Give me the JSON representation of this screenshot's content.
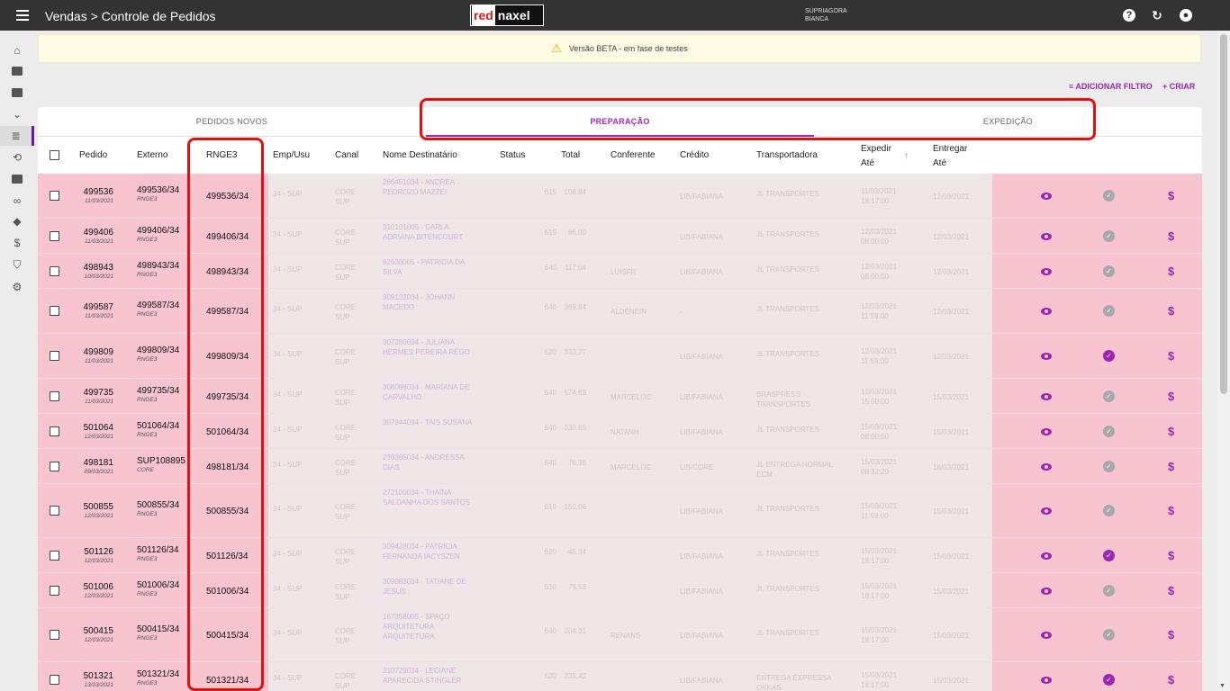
{
  "header": {
    "breadcrumb": "Vendas > Controle de Pedidos",
    "logo_red": "red",
    "logo_rest": "naxel",
    "user_line1": "SUPRIAGORA",
    "user_line2": "BIANCA"
  },
  "banner": {
    "text": "Versão BETA - em fase de testes"
  },
  "actions": {
    "filter": "ADICIONAR FILTRO",
    "create": "CRIAR"
  },
  "tabs": [
    {
      "label": "PEDIDOS NOVOS"
    },
    {
      "label": "PREPARAÇÃO"
    },
    {
      "label": "EXPEDIÇÃO"
    }
  ],
  "columns": {
    "pedido": "Pedido",
    "externo": "Externo",
    "rnge3": "RNGE3",
    "emp": "Emp/Usu",
    "canal": "Canal",
    "nome": "Nome Destinatário",
    "status": "Status",
    "total": "Total",
    "conferente": "Conferente",
    "credito": "Crédito",
    "transportadora": "Transportadora",
    "expedir1": "Expedir",
    "expedir2": "Até",
    "entregar1": "Entregar",
    "entregar2": "Até"
  },
  "rows": [
    {
      "pedido": "499536",
      "date": "11/03/2021",
      "externo": "499536/34",
      "sub": "RNGE3",
      "rnge": "499536/34",
      "nome": "266451034 - ANDREA PEDROZO MAZZEI",
      "status": "615",
      "total": "108,84",
      "conf": "",
      "cred": "LIB/FABIANA",
      "trans": "JL TRANSPORTES",
      "exp": "11/03/2021",
      "exp2": "18:17:00",
      "ent": "12/03/2021",
      "done": false
    },
    {
      "pedido": "499406",
      "date": "11/03/2021",
      "externo": "499406/34",
      "sub": "RNGE3",
      "rnge": "499406/34",
      "nome": "310101005 - CARLA ADRIANA BITENCOURT",
      "status": "615",
      "total": "86,00",
      "conf": "",
      "cred": "LIB/FABIANA",
      "trans": "JL TRANSPORTES",
      "exp": "12/03/2021",
      "exp2": "08:00:00",
      "ent": "12/03/2021",
      "done": false
    },
    {
      "pedido": "498943",
      "date": "10/03/2021",
      "externo": "498943/34",
      "sub": "RNGE3",
      "rnge": "498943/34",
      "nome": "62530005 - PATRICIA DA SILVA",
      "status": "640",
      "total": "117,04",
      "conf": "LUISFR",
      "cred": "LIB/FABIANA",
      "trans": "JL TRANSPORTES",
      "exp": "12/03/2021",
      "exp2": "08:00:00",
      "ent": "12/03/2021",
      "done": false
    },
    {
      "pedido": "499587",
      "date": "11/03/2021",
      "externo": "499587/34",
      "sub": "RNGE3",
      "rnge": "499587/34",
      "nome": "309132034 - JOHANN MACEDO",
      "status": "640",
      "total": "369,84",
      "conf": "ALDENEIN",
      "cred": "-",
      "trans": "JL TRANSPORTES",
      "exp": "12/03/2021",
      "exp2": "11:59:00",
      "ent": "12/03/2021",
      "done": false
    },
    {
      "pedido": "499809",
      "date": "11/03/2021",
      "externo": "499809/34",
      "sub": "RNGE3",
      "rnge": "499809/34",
      "nome": "307280034 - JULIANA HERMES PEREIRA RÊGO",
      "status": "620",
      "total": "333,77",
      "conf": "",
      "cred": "LIB/FABIANA",
      "trans": "JL TRANSPORTES",
      "exp": "12/03/2021",
      "exp2": "11:59:00",
      "ent": "12/03/2021",
      "done": true
    },
    {
      "pedido": "499735",
      "date": "11/03/2021",
      "externo": "499735/34",
      "sub": "RNGE3",
      "rnge": "499735/34",
      "nome": "308088034 - MARIANA DE CARVALHO",
      "status": "640",
      "total": "574,69",
      "conf": "MARCELOC",
      "cred": "LIB/FABIANA",
      "trans": "BRASPRESS TRANSPORTES",
      "exp": "12/03/2021",
      "exp2": "15:00:00",
      "ent": "15/03/2021",
      "done": false
    },
    {
      "pedido": "501064",
      "date": "12/03/2021",
      "externo": "501064/34",
      "sub": "RNGE3",
      "rnge": "501064/34",
      "nome": "307944034 - TAIS SUSANA",
      "status": "640",
      "total": "230,85",
      "conf": "NATANH",
      "cred": "LIB/FABIANA",
      "trans": "JL TRANSPORTES",
      "exp": "15/03/2021",
      "exp2": "08:00:00",
      "ent": "15/03/2021",
      "done": false
    },
    {
      "pedido": "498181",
      "date": "09/03/2021",
      "externo": "SUP108895",
      "sub": "CORE",
      "rnge": "498181/34",
      "nome": "239365034 - ANDRESSA DIAS",
      "status": "640",
      "total": "76,36",
      "conf": "MARCELOC",
      "cred": "LIB/CORE",
      "trans": "JL ENTREGA NORMAL ECM",
      "exp": "15/03/2021",
      "exp2": "08:32:20",
      "ent": "16/03/2021",
      "done": false
    },
    {
      "pedido": "500855",
      "date": "12/03/2021",
      "externo": "500855/34",
      "sub": "RNGE3",
      "rnge": "500855/34",
      "nome": "272100034 - THAÍNA SALDANHA DOS SANTOS",
      "status": "610",
      "total": "150,06",
      "conf": "",
      "cred": "LIB/FABIANA",
      "trans": "JL TRANSPORTES",
      "exp": "15/03/2021",
      "exp2": "11:59:00",
      "ent": "15/03/2021",
      "done": false
    },
    {
      "pedido": "501126",
      "date": "12/03/2021",
      "externo": "501126/34",
      "sub": "RNGE3",
      "rnge": "501126/34",
      "nome": "309428034 - PATRÍCIA FERNANDA IACYSZEN",
      "status": "620",
      "total": "45,34",
      "conf": "",
      "cred": "LIB/FABIANA",
      "trans": "JL TRANSPORTES",
      "exp": "15/03/2021",
      "exp2": "18:17:00",
      "ent": "15/03/2021",
      "done": true
    },
    {
      "pedido": "501006",
      "date": "12/03/2021",
      "externo": "501006/34",
      "sub": "RNGE3",
      "rnge": "501006/34",
      "nome": "309083034 - TATIANE DE JESUS",
      "status": "610",
      "total": "78,52",
      "conf": "",
      "cred": "LIB/FABIANA",
      "trans": "JL TRANSPORTES",
      "exp": "15/03/2021",
      "exp2": "18:17:00",
      "ent": "15/03/2021",
      "done": false
    },
    {
      "pedido": "500415",
      "date": "12/03/2021",
      "externo": "500415/34",
      "sub": "RNGE3",
      "rnge": "500415/34",
      "nome": "167358005 - SPAÇO ARQUITETURA ARQUITETURA",
      "status": "640",
      "total": "204,31",
      "conf": "RENANS",
      "cred": "LIB/FABIANA",
      "trans": "JL TRANSPORTES",
      "exp": "15/03/2021",
      "exp2": "18:17:00",
      "ent": "15/03/2021",
      "done": false
    },
    {
      "pedido": "501321",
      "date": "13/03/2021",
      "externo": "501321/34",
      "sub": "RNGE3",
      "rnge": "501321/34",
      "nome": "310729034 - LECIANE APARECIDA STINGLER",
      "status": "620",
      "total": "235,42",
      "conf": "",
      "cred": "LIB/FABIANA",
      "trans": "ENTREGA EXPRESSA OKKAS",
      "exp": "15/03/2021",
      "exp2": "18:17:00",
      "ent": "15/03/2021",
      "done": true
    }
  ],
  "emp_text": "34 - SUP",
  "canal_text": "CORE SUP"
}
